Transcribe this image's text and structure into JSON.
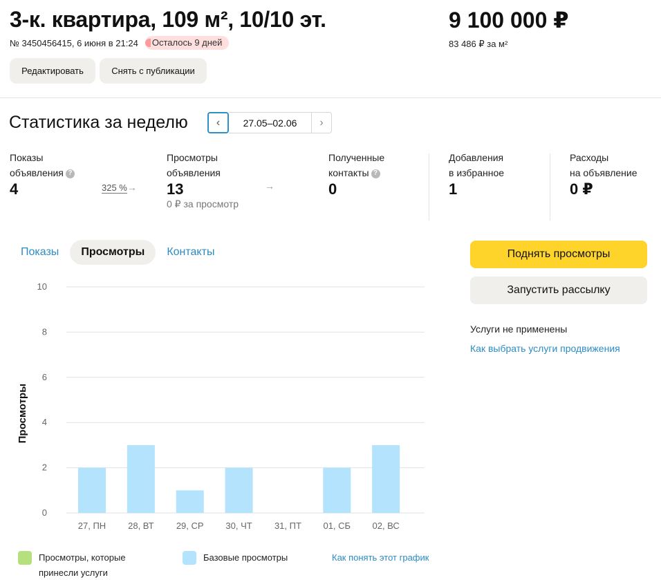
{
  "listing": {
    "title": "3-к. квартира, 109 м², 10/10 эт.",
    "meta": "№ 3450456415, 6 июня в 21:24",
    "badge": "Осталось 9 дней",
    "price": "9 100 000 ₽",
    "price_per_sqm": "83 486 ₽ за м²",
    "edit_label": "Редактировать",
    "unpublish_label": "Снять с публикации"
  },
  "stats": {
    "title": "Статистика за неделю",
    "range": "27.05–02.06",
    "prev_icon": "chevron-left-icon",
    "next_icon": "chevron-right-icon",
    "metrics": [
      {
        "label1": "Показы",
        "label2": "объявления",
        "value": "4",
        "help": true,
        "change": "325 %"
      },
      {
        "label1": "Просмотры",
        "label2": "объявления",
        "value": "13",
        "sub": "0 ₽ за просмотр"
      },
      {
        "label1": "Полученные",
        "label2": "контакты",
        "value": "0",
        "help": true
      },
      {
        "label1": "Добавления",
        "label2": "в избранное",
        "value": "1"
      },
      {
        "label1": "Расходы",
        "label2": "на объявление",
        "value": "0 ₽"
      }
    ]
  },
  "tabs": [
    "Показы",
    "Просмотры",
    "Контакты"
  ],
  "active_tab": "Просмотры",
  "actions": {
    "raise_views": "Поднять просмотры",
    "mailing": "Запустить рассылку",
    "services_none": "Услуги не применены",
    "services_link": "Как выбрать услуги продвижения"
  },
  "legend": {
    "paid_label_line1": "Просмотры, которые",
    "paid_label_line2": "принесли услуги",
    "base_label": "Базовые просмотры",
    "help_link": "Как понять этот график",
    "paid_color": "#b5e07d",
    "base_color": "#b3e3fd"
  },
  "chart_data": {
    "type": "bar",
    "ylabel": "Просмотры",
    "xlabel": "",
    "categories": [
      "27, ПН",
      "28, ВТ",
      "29, СР",
      "30, ЧТ",
      "31, ПТ",
      "01, СБ",
      "02, ВС"
    ],
    "series": [
      {
        "name": "Просмотры, которые принесли услуги",
        "values": [
          0,
          0,
          0,
          0,
          0,
          0,
          0
        ],
        "color": "#b5e07d"
      },
      {
        "name": "Базовые просмотры",
        "values": [
          2,
          3,
          1,
          2,
          0,
          2,
          3
        ],
        "color": "#b3e3fd"
      }
    ],
    "ylim": [
      0,
      10
    ],
    "yticks": [
      0,
      2,
      4,
      6,
      8,
      10
    ],
    "grid": true
  }
}
